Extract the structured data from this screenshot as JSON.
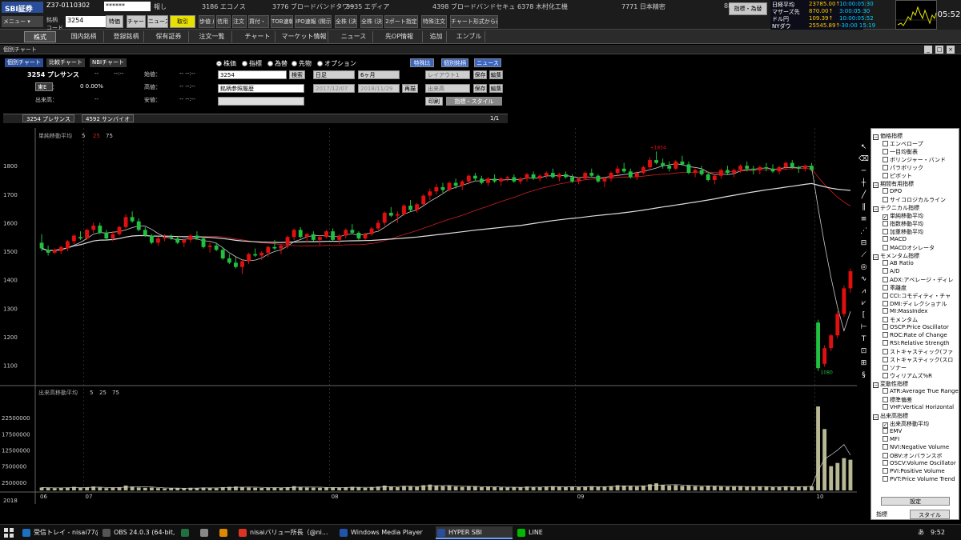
{
  "app": {
    "logo": "SBI証券",
    "account": "Z37-0110302",
    "password_mask": "******",
    "code_value": "3254",
    "tickers": [
      "報し",
      "3186 エコノス",
      "3776 ブロードバンドタワー",
      "3935 エディア",
      "4398 ブロードバンドセキュ",
      "6378 木村化工機",
      "7771 日本精密",
      "88"
    ],
    "toolbar_buttons": [
      "特価",
      "チャート",
      "ニュース",
      "取引",
      "歩値 成績",
      "信用 規制",
      "注文 照会",
      "買付・ 建余力",
      "TOB速報",
      "IPO速報 (開示)",
      "全株 (決算)",
      "全株 (決算)",
      "2ポート指定",
      "特殊注文",
      "チャート形式から表示"
    ],
    "market_button": "指標・為替",
    "indices": [
      {
        "name": "日経平均",
        "value": "23785.00↑",
        "time": "10:00:05:30"
      },
      {
        "name": "マザーズ先",
        "value": "870.00↑",
        "time": "3:00:05:30"
      },
      {
        "name": "ドル円",
        "value": "109.39↑",
        "time": "10:00:05:52"
      },
      {
        "name": "NYダウ",
        "value": "25545.89↑",
        "time": "-30:00 15:19"
      }
    ],
    "clock": "05:52"
  },
  "menu": {
    "tabs": [
      "株式",
      "国内銘柄",
      "登録銘柄",
      "保有証券",
      "注文一覧",
      "チャート",
      "マーケット情報",
      "ニュース",
      "先OP情報",
      "追加",
      "エンブル"
    ],
    "active": "株式"
  },
  "window": {
    "title": "個別チャート",
    "buttons": [
      "_",
      "□",
      "×"
    ]
  },
  "controls": {
    "tabs": [
      "個別チャート",
      "比較チャート",
      "NBIチャート"
    ],
    "stock_title": "3254 プレサンス",
    "ohlc_labels": [
      {
        "label": "--",
        "value": "--:--",
        "label2": "始値：",
        "value2": "-- --:--"
      },
      {
        "label": "前日比：",
        "value": "0  0.00%",
        "label2": "高値：",
        "value2": "-- --:--"
      },
      {
        "label": "出来高：",
        "value": "--",
        "label2": "安値：",
        "value2": "-- --:--"
      }
    ],
    "market_label": "東E",
    "radios": [
      "株価",
      "指標",
      "為替",
      "先物",
      "オプション"
    ],
    "radio_selected": "株価",
    "code_input": "3254",
    "search_button": "検索",
    "sector_select": "銘柄参照履歴",
    "period_select": "日足",
    "range_select": "6ヶ月",
    "date_from": "2017/12/07",
    "date_to": "2018/11/29",
    "apply_button": "再描",
    "chart_type_select": "レイアウト1",
    "save_button": "保存",
    "edit_button": "編集",
    "display_select": "出来高",
    "save_button2": "保存",
    "edit_button2": "編集",
    "print_button": "印刷",
    "style_button": "指標・スタイル",
    "special_buttons": [
      "特殊比",
      "個別銘柄",
      "ニュース"
    ],
    "chart_tabs": [
      "3254 プレサンス",
      "4592 サンバイオ"
    ],
    "page_indicator": "1/1"
  },
  "chart_data": {
    "type": "candlestick",
    "price_panel_label": "単純移動平均",
    "ma_periods": [
      "5",
      "25",
      "75"
    ],
    "volume_panel_label": "出来高移動平均",
    "volume_ma_periods": [
      "5",
      "25",
      "75"
    ],
    "y_ticks": [
      1800,
      1700,
      1600,
      1500,
      1400,
      1300,
      1200,
      1100
    ],
    "ylim": [
      1040,
      1910
    ],
    "volume_ticks": [
      "22500000",
      "17500000",
      "12500000",
      "7500000",
      "2500000"
    ],
    "volume_ylim": [
      0,
      28000000
    ],
    "x_labels": [
      "06",
      "07",
      "08",
      "09",
      "10",
      "11",
      "12"
    ],
    "year_label": "2018",
    "high_marker": "+1854",
    "low_marker": "1080",
    "candles": [
      [
        1530,
        1560,
        1500,
        1510
      ],
      [
        1505,
        1520,
        1485,
        1495
      ],
      [
        1495,
        1510,
        1490,
        1505
      ],
      [
        1500,
        1520,
        1490,
        1515
      ],
      [
        1510,
        1540,
        1500,
        1535
      ],
      [
        1535,
        1560,
        1525,
        1555
      ],
      [
        1550,
        1570,
        1540,
        1545
      ],
      [
        1545,
        1580,
        1540,
        1575
      ],
      [
        1575,
        1600,
        1565,
        1590
      ],
      [
        1590,
        1600,
        1560,
        1565
      ],
      [
        1565,
        1575,
        1540,
        1545
      ],
      [
        1545,
        1570,
        1535,
        1560
      ],
      [
        1560,
        1590,
        1555,
        1585
      ],
      [
        1585,
        1630,
        1580,
        1620
      ],
      [
        1620,
        1640,
        1600,
        1605
      ],
      [
        1605,
        1615,
        1570,
        1575
      ],
      [
        1575,
        1585,
        1550,
        1555
      ],
      [
        1555,
        1560,
        1525,
        1530
      ],
      [
        1530,
        1550,
        1520,
        1545
      ],
      [
        1545,
        1560,
        1535,
        1550
      ],
      [
        1550,
        1560,
        1540,
        1545
      ],
      [
        1545,
        1550,
        1525,
        1530
      ],
      [
        1530,
        1545,
        1515,
        1540
      ],
      [
        1540,
        1560,
        1530,
        1555
      ],
      [
        1555,
        1570,
        1540,
        1545
      ],
      [
        1545,
        1550,
        1510,
        1515
      ],
      [
        1515,
        1530,
        1495,
        1520
      ],
      [
        1520,
        1530,
        1500,
        1505
      ],
      [
        1505,
        1515,
        1470,
        1475
      ],
      [
        1475,
        1490,
        1455,
        1460
      ],
      [
        1460,
        1480,
        1440,
        1445
      ],
      [
        1445,
        1470,
        1420,
        1465
      ],
      [
        1465,
        1495,
        1455,
        1490
      ],
      [
        1490,
        1510,
        1480,
        1485
      ],
      [
        1485,
        1500,
        1470,
        1495
      ],
      [
        1495,
        1520,
        1480,
        1515
      ],
      [
        1515,
        1540,
        1505,
        1510
      ],
      [
        1510,
        1525,
        1490,
        1520
      ],
      [
        1520,
        1555,
        1510,
        1550
      ],
      [
        1550,
        1580,
        1540,
        1575
      ],
      [
        1575,
        1585,
        1545,
        1550
      ],
      [
        1550,
        1565,
        1530,
        1560
      ],
      [
        1560,
        1570,
        1535,
        1540
      ],
      [
        1540,
        1555,
        1520,
        1550
      ],
      [
        1550,
        1575,
        1545,
        1570
      ],
      [
        1570,
        1580,
        1535,
        1540
      ],
      [
        1540,
        1560,
        1525,
        1555
      ],
      [
        1555,
        1580,
        1545,
        1575
      ],
      [
        1575,
        1595,
        1560,
        1565
      ],
      [
        1565,
        1570,
        1540,
        1545
      ],
      [
        1545,
        1565,
        1540,
        1560
      ],
      [
        1560,
        1585,
        1555,
        1580
      ],
      [
        1580,
        1610,
        1575,
        1600
      ],
      [
        1600,
        1640,
        1590,
        1635
      ],
      [
        1635,
        1655,
        1620,
        1625
      ],
      [
        1625,
        1640,
        1600,
        1630
      ],
      [
        1630,
        1665,
        1625,
        1660
      ],
      [
        1660,
        1680,
        1640,
        1645
      ],
      [
        1645,
        1670,
        1635,
        1665
      ],
      [
        1665,
        1700,
        1660,
        1695
      ],
      [
        1695,
        1720,
        1680,
        1710
      ],
      [
        1710,
        1735,
        1700,
        1725
      ],
      [
        1725,
        1740,
        1705,
        1715
      ],
      [
        1715,
        1745,
        1710,
        1740
      ],
      [
        1740,
        1755,
        1720,
        1730
      ],
      [
        1730,
        1750,
        1715,
        1745
      ],
      [
        1745,
        1770,
        1735,
        1765
      ],
      [
        1765,
        1775,
        1745,
        1755
      ],
      [
        1755,
        1765,
        1735,
        1740
      ],
      [
        1740,
        1760,
        1730,
        1755
      ],
      [
        1755,
        1770,
        1740,
        1745
      ],
      [
        1745,
        1760,
        1730,
        1755
      ],
      [
        1755,
        1765,
        1745,
        1760
      ],
      [
        1760,
        1770,
        1740,
        1745
      ],
      [
        1745,
        1760,
        1735,
        1755
      ],
      [
        1755,
        1775,
        1745,
        1770
      ],
      [
        1770,
        1780,
        1750,
        1755
      ],
      [
        1755,
        1770,
        1745,
        1765
      ],
      [
        1765,
        1780,
        1755,
        1775
      ],
      [
        1775,
        1790,
        1755,
        1760
      ],
      [
        1760,
        1775,
        1745,
        1770
      ],
      [
        1770,
        1780,
        1755,
        1760
      ],
      [
        1760,
        1770,
        1740,
        1745
      ],
      [
        1745,
        1760,
        1735,
        1755
      ],
      [
        1755,
        1780,
        1750,
        1775
      ],
      [
        1775,
        1790,
        1760,
        1765
      ],
      [
        1765,
        1770,
        1740,
        1745
      ],
      [
        1745,
        1760,
        1725,
        1755
      ],
      [
        1755,
        1780,
        1745,
        1775
      ],
      [
        1775,
        1800,
        1765,
        1790
      ],
      [
        1790,
        1810,
        1775,
        1780
      ],
      [
        1780,
        1790,
        1755,
        1760
      ],
      [
        1760,
        1780,
        1750,
        1775
      ],
      [
        1775,
        1800,
        1770,
        1795
      ],
      [
        1795,
        1830,
        1785,
        1820
      ],
      [
        1820,
        1850,
        1805,
        1810
      ],
      [
        1810,
        1825,
        1790,
        1800
      ],
      [
        1800,
        1815,
        1780,
        1790
      ],
      [
        1790,
        1820,
        1785,
        1815
      ],
      [
        1815,
        1835,
        1800,
        1805
      ],
      [
        1805,
        1815,
        1770,
        1775
      ],
      [
        1775,
        1790,
        1760,
        1785
      ],
      [
        1785,
        1800,
        1765,
        1770
      ],
      [
        1770,
        1780,
        1745,
        1750
      ],
      [
        1750,
        1770,
        1735,
        1765
      ],
      [
        1765,
        1790,
        1755,
        1785
      ],
      [
        1785,
        1800,
        1770,
        1775
      ],
      [
        1775,
        1790,
        1760,
        1785
      ],
      [
        1785,
        1805,
        1775,
        1800
      ],
      [
        1800,
        1815,
        1780,
        1790
      ],
      [
        1790,
        1800,
        1770,
        1785
      ],
      [
        1785,
        1800,
        1770,
        1795
      ],
      [
        1795,
        1810,
        1780,
        1790
      ],
      [
        1790,
        1805,
        1775,
        1780
      ],
      [
        1780,
        1800,
        1770,
        1795
      ],
      [
        1795,
        1815,
        1785,
        1810
      ],
      [
        1810,
        1820,
        1790,
        1795
      ],
      [
        1795,
        1800,
        1775,
        1790
      ],
      [
        1790,
        1805,
        1780,
        1800
      ],
      [
        1800,
        1810,
        1780,
        1785
      ],
      [
        1250,
        1260,
        1080,
        1090
      ],
      [
        1105,
        1170,
        1095,
        1160
      ],
      [
        1160,
        1210,
        1150,
        1205
      ],
      [
        1205,
        1290,
        1195,
        1280
      ],
      [
        1280,
        1380,
        1270,
        1370
      ],
      [
        1370,
        1440,
        1355,
        1430
      ]
    ],
    "volumes": [
      900000,
      800000,
      700000,
      750000,
      900000,
      1100000,
      800000,
      900000,
      1200000,
      900000,
      700000,
      800000,
      1000000,
      1500000,
      1200000,
      900000,
      800000,
      900000,
      700000,
      600000,
      650000,
      700000,
      750000,
      800000,
      700000,
      900000,
      800000,
      700000,
      1000000,
      1100000,
      1200000,
      1000000,
      900000,
      800000,
      750000,
      850000,
      900000,
      800000,
      1000000,
      1300000,
      1100000,
      900000,
      850000,
      800000,
      900000,
      950000,
      850000,
      1000000,
      1100000,
      900000,
      800000,
      1000000,
      1200000,
      1500000,
      1200000,
      1000000,
      1400000,
      1300000,
      1100000,
      1600000,
      1800000,
      1500000,
      1300000,
      1400000,
      1200000,
      1100000,
      1300000,
      1200000,
      1000000,
      1100000,
      1000000,
      950000,
      900000,
      1000000,
      950000,
      1200000,
      1100000,
      1000000,
      1200000,
      1300000,
      1100000,
      1000000,
      1100000,
      1000000,
      1200000,
      1300000,
      1100000,
      1200000,
      1300000,
      1600000,
      1500000,
      1300000,
      1200000,
      1400000,
      1900000,
      2200000,
      1700000,
      1500000,
      1600000,
      1400000,
      1600000,
      1300000,
      1200000,
      1400000,
      1300000,
      1200000,
      1100000,
      1200000,
      1300000,
      1200000,
      1100000,
      1200000,
      1100000,
      1000000,
      1100000,
      1300000,
      1200000,
      1100000,
      1200000,
      1300000,
      26000000,
      19000000,
      7500000,
      8500000,
      10000000,
      9500000
    ],
    "colors": {
      "up": "#e01010",
      "down": "#20c040",
      "ma5": "#cccccc",
      "ma25": "#d02020",
      "ma75": "#e0e0e0",
      "volume": "#b8b894",
      "grid": "#444444"
    }
  },
  "tools": [
    "arrow",
    "eraser",
    "hline",
    "cross",
    "trend",
    "parallel",
    "fib",
    "fan",
    "channel",
    "gann",
    "cycle",
    "wave",
    "pitch",
    "zigzag",
    "bracket",
    "ruler",
    "text",
    "lock",
    "stamp",
    "swirl"
  ],
  "indicator_panel": {
    "groups": [
      {
        "name": "価格指標",
        "items": [
          {
            "label": "エンベロープ",
            "checked": false
          },
          {
            "label": "一目均衡表",
            "checked": false
          },
          {
            "label": "ボリンジャー・バンド",
            "checked": false
          },
          {
            "label": "パラボリック",
            "checked": false
          },
          {
            "label": "ピボット",
            "checked": false
          }
        ]
      },
      {
        "name": "期間有用指標",
        "items": [
          {
            "label": "DPO",
            "checked": false
          },
          {
            "label": "サイコロジカルライン",
            "checked": false
          }
        ]
      },
      {
        "name": "テクニカル指標",
        "items": [
          {
            "label": "単純移動平均",
            "checked": true
          },
          {
            "label": "指数移動平均",
            "checked": false
          },
          {
            "label": "加重移動平均",
            "checked": false
          },
          {
            "label": "MACD",
            "checked": false
          },
          {
            "label": "MACDオシレータ",
            "checked": false
          }
        ]
      },
      {
        "name": "モメンタム指標",
        "items": [
          {
            "label": "AB Ratio",
            "checked": false
          },
          {
            "label": "A/D",
            "checked": false
          },
          {
            "label": "ADX:アベレージ・ディレ",
            "checked": false
          },
          {
            "label": "乖離度",
            "checked": false
          },
          {
            "label": "CCI:コモディティ・チャ",
            "checked": false
          },
          {
            "label": "DMI:ディレクショナル",
            "checked": false
          },
          {
            "label": "MI:MassIndex",
            "checked": false
          },
          {
            "label": "モメンタム",
            "checked": false
          },
          {
            "label": "OSCP:Price Oscillator",
            "checked": false
          },
          {
            "label": "ROC:Rate of Change",
            "checked": false
          },
          {
            "label": "RSI:Relative Strength",
            "checked": false
          },
          {
            "label": "ストキャスティック(ファ",
            "checked": false
          },
          {
            "label": "ストキャスティック(スロ",
            "checked": false
          },
          {
            "label": "ソナー",
            "checked": false
          },
          {
            "label": "ウィリアムズ%R",
            "checked": false
          }
        ]
      },
      {
        "name": "変動性指標",
        "items": [
          {
            "label": "ATR:Average True Range",
            "checked": false
          },
          {
            "label": "標準偏差",
            "checked": false
          },
          {
            "label": "VHF:Vertical Horizontal",
            "checked": false
          }
        ]
      },
      {
        "name": "出来高指標",
        "items": [
          {
            "label": "出来高移動平均",
            "checked": true
          },
          {
            "label": "EMV",
            "checked": false
          },
          {
            "label": "MFI",
            "checked": false
          },
          {
            "label": "NVI:Negative Volume",
            "checked": false
          },
          {
            "label": "OBV:オンバランスボ",
            "checked": false
          },
          {
            "label": "OSCV:Volume Oscillator",
            "checked": false
          },
          {
            "label": "PVI:Positive Volume",
            "checked": false
          },
          {
            "label": "PVT:Price Volume Trend",
            "checked": false
          }
        ]
      }
    ],
    "settings_button": "設定",
    "tabs": [
      "指標",
      "スタイル"
    ]
  },
  "taskbar": {
    "items": [
      {
        "label": "受信トレイ - nisai77@z...",
        "color": "#1e70c0"
      },
      {
        "label": "OBS 24.0.3 (64-bit, wi...",
        "color": "#555555"
      },
      {
        "label": "",
        "color": "#207040"
      },
      {
        "label": "",
        "color": "#888888"
      },
      {
        "label": "",
        "color": "#dd8800"
      },
      {
        "label": "nisaiバリュー所長（@ni...",
        "color": "#dd3322"
      },
      {
        "label": "Windows Media Player",
        "color": "#2255aa"
      },
      {
        "label": "HYPER SBI",
        "color": "#2a4e9a"
      },
      {
        "label": "LINE",
        "color": "#00b900"
      }
    ],
    "time": "9:52",
    "lang": "あ"
  }
}
